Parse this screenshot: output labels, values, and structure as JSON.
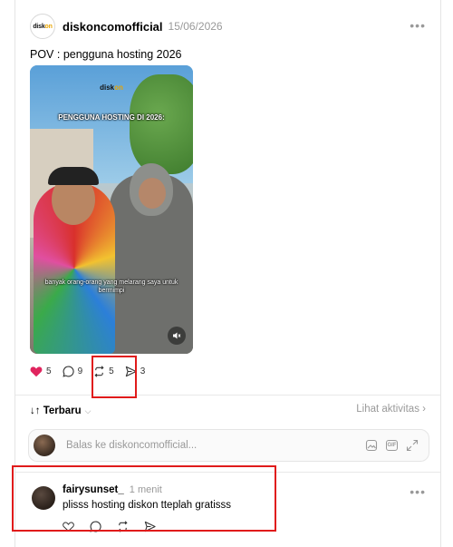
{
  "post": {
    "author": "diskoncomofficial",
    "date": "15/06/2026",
    "caption": "POV : pengguna hosting 2026",
    "logo": {
      "text_main": "disk",
      "text_accent": "on"
    },
    "media": {
      "brand_main": "disk",
      "brand_accent": "on",
      "overlay_title": "PENGGUNA HOSTING DI 2026:",
      "overlay_subtitle": "banyak orang-orang yang melarang saya untuk bermimpi"
    },
    "stats": {
      "likes": "5",
      "comments": "9",
      "reposts": "5",
      "shares": "3"
    },
    "more_icon": "more-horizontal-icon"
  },
  "replies": {
    "sort_label": "↓↑ Terbaru",
    "activity_link": "Lihat aktivitas",
    "reply_placeholder": "Balas ke diskoncomofficial...",
    "gif_label": "GIF"
  },
  "comment": {
    "user": "fairysunset_",
    "time": "1 menit",
    "text": "plisss hosting diskon tteplah gratisss"
  },
  "colors": {
    "like": "#e0245e",
    "muted": "#999999",
    "highlight": "#e01b1b",
    "accent": "#e9a400"
  }
}
